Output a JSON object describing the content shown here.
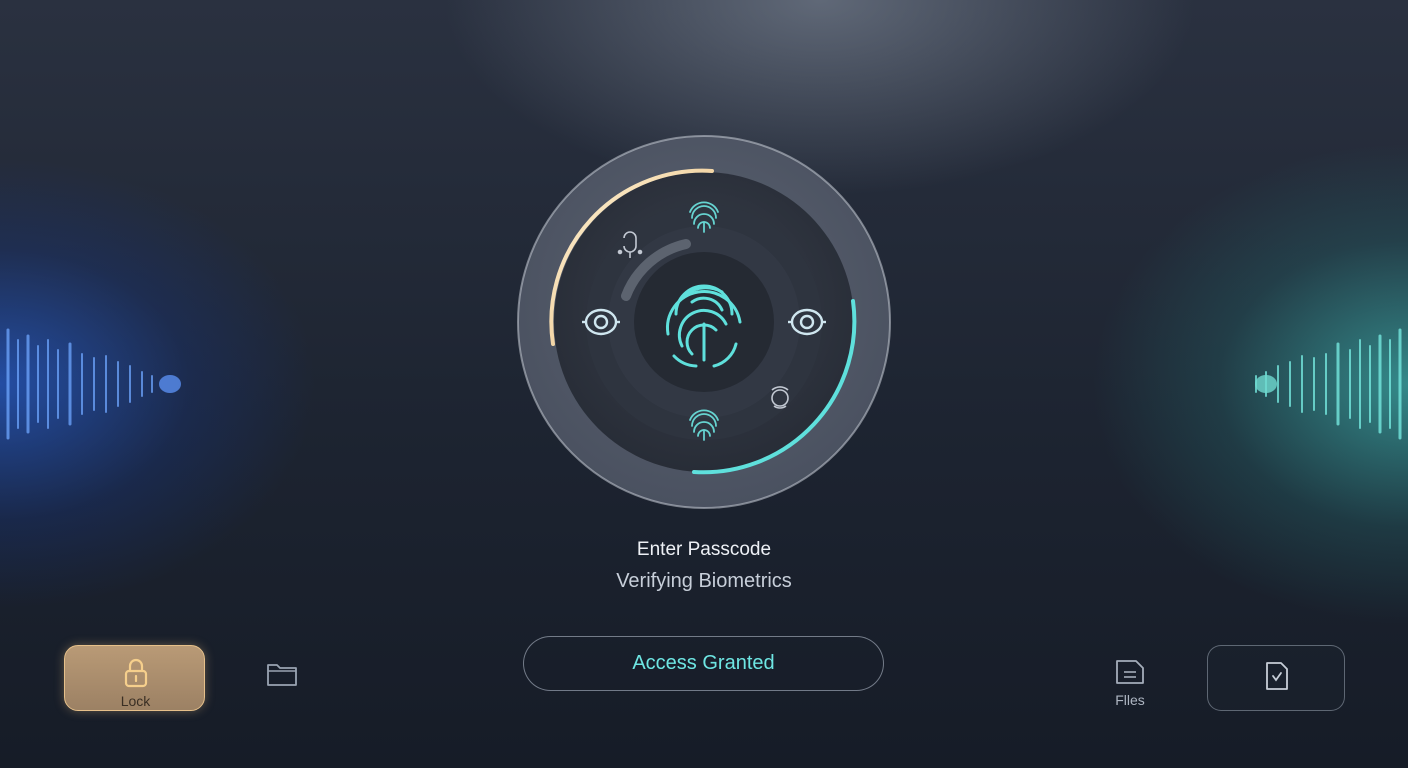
{
  "prompt": {
    "title": "Enter Passcode",
    "subtitle": "Verifying Biometrics"
  },
  "actions": {
    "access_button_label": "Access Granted"
  },
  "dock": {
    "lock": {
      "label": "Lock",
      "icon": "lock-icon",
      "active": true
    },
    "folder": {
      "icon": "folder-icon"
    },
    "files": {
      "label": "Flles",
      "icon": "files-icon"
    },
    "file_check": {
      "icon": "file-check-icon"
    }
  },
  "biometric_dial": {
    "center_icon": "fingerprint-icon",
    "orbit_icons": [
      "fingerprint-icon",
      "eye-scan-icon",
      "eye-scan-icon",
      "fingerprint-icon",
      "voice-icon",
      "face-icon"
    ],
    "progress_warm": 0.25,
    "progress_cool": 0.25
  },
  "colors": {
    "accent_cyan": "#5fe0dc",
    "accent_warm": "#f2c98e",
    "glow_left": "#2f6dff",
    "glow_right": "#4fded4"
  }
}
